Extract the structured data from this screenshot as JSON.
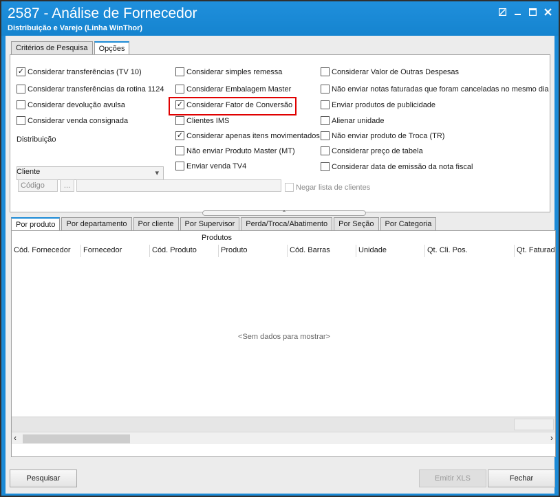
{
  "window": {
    "title": "2587 - Análise de Fornecedor",
    "subtitle": "Distribuição e Varejo (Linha WinThor)"
  },
  "top_tabs": [
    {
      "label": "Critérios de Pesquisa",
      "active": false
    },
    {
      "label": "Opções",
      "active": true
    }
  ],
  "options": {
    "col1": [
      {
        "label": "Considerar transferências (TV 10)",
        "checked": true
      },
      {
        "label": "Considerar transferências da rotina 1124",
        "checked": false
      },
      {
        "label": "Considerar devolução avulsa",
        "checked": false
      },
      {
        "label": "Considerar venda consignada",
        "checked": false
      }
    ],
    "col2": [
      {
        "label": "Considerar simples remessa",
        "checked": false
      },
      {
        "label": "Considerar Embalagem Master",
        "checked": false
      },
      {
        "label": "Considerar Fator de Conversão",
        "checked": true
      },
      {
        "label": "Clientes IMS",
        "checked": false
      },
      {
        "label": "Considerar apenas itens movimentados",
        "checked": true
      },
      {
        "label": "Não enviar Produto Master (MT)",
        "checked": false
      },
      {
        "label": "Enviar venda TV4",
        "checked": false
      }
    ],
    "col3": [
      {
        "label": "Considerar Valor de Outras Despesas",
        "checked": false
      },
      {
        "label": "Não enviar notas faturadas que foram canceladas no mesmo dia",
        "checked": false
      },
      {
        "label": "Enviar produtos de publicidade",
        "checked": false
      },
      {
        "label": "Alienar unidade",
        "checked": false
      },
      {
        "label": "Não enviar produto de Troca (TR)",
        "checked": false
      },
      {
        "label": "Considerar preço de tabela",
        "checked": false
      },
      {
        "label": "Considerar data de emissão da nota fiscal",
        "checked": false
      }
    ],
    "distribuicao_label": "Distribuição",
    "distribuicao_value": "",
    "cliente_label": "Cliente",
    "cliente_codigo_placeholder": "Código",
    "cliente_browse": "...",
    "negar_lista": {
      "label": "Negar lista de clientes",
      "checked": false
    }
  },
  "bottom_tabs": [
    {
      "label": "Por produto",
      "active": true
    },
    {
      "label": "Por departamento",
      "active": false
    },
    {
      "label": "Por cliente",
      "active": false
    },
    {
      "label": "Por Supervisor",
      "active": false
    },
    {
      "label": "Perda/Troca/Abatimento",
      "active": false
    },
    {
      "label": "Por Seção",
      "active": false
    },
    {
      "label": "Por Categoria",
      "active": false
    }
  ],
  "grid": {
    "band": "Produtos",
    "columns": [
      "Cód. Fornecedor",
      "Fornecedor",
      "Cód. Produto",
      "Produto",
      "Cód. Barras",
      "Unidade",
      "Qt. Cli. Pos.",
      "Qt. Faturada"
    ],
    "empty_text": "<Sem dados para mostrar>"
  },
  "buttons": {
    "pesquisar": "Pesquisar",
    "emitir_xls": "Emitir XLS",
    "fechar": "Fechar"
  },
  "colors": {
    "titlebar": "#1b8ad6",
    "highlight": "#e00000"
  }
}
